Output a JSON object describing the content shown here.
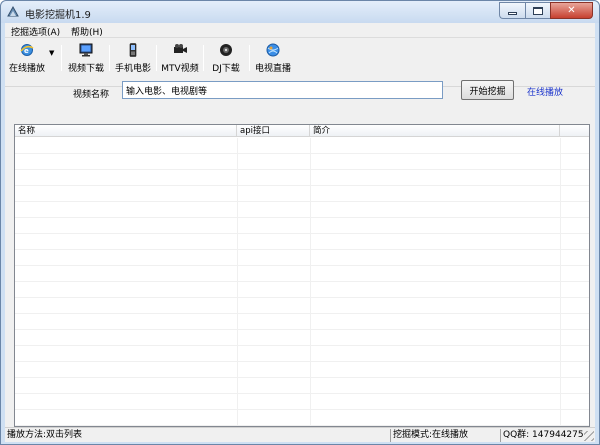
{
  "window": {
    "title": "电影挖掘机1.9",
    "controls": {
      "minimize": "minimize-icon",
      "maximize": "maximize-icon",
      "close_glyph": "✕"
    }
  },
  "menu": {
    "items": [
      {
        "label": "挖掘选项(A)"
      },
      {
        "label": "帮助(H)"
      }
    ]
  },
  "toolbar": {
    "items": [
      {
        "label": "在线播放",
        "icon": "ie-globe-icon",
        "dropdown": "▼"
      },
      {
        "label": "视频下载",
        "icon": "monitor-icon"
      },
      {
        "label": "手机电影",
        "icon": "mobile-phone-icon"
      },
      {
        "label": "MTV视频",
        "icon": "video-camera-icon"
      },
      {
        "label": "DJ下载",
        "icon": "speaker-icon"
      },
      {
        "label": "电视直播",
        "icon": "tv-globe-icon"
      }
    ]
  },
  "search": {
    "label": "视频名称",
    "value": "输入电影、电视剧等",
    "button": "开始挖掘",
    "mode_link": "在线播放"
  },
  "table": {
    "columns": [
      "名称",
      "api接口",
      "简介"
    ],
    "rows": []
  },
  "status": {
    "play_method": "播放方法:双击列表",
    "mode": "挖掘模式:在线播放",
    "qq": "QQ群: 147944275"
  },
  "colors": {
    "accent_link": "#1c35cc",
    "title_bg": "#c8daf0",
    "close_button": "#c7402f"
  }
}
